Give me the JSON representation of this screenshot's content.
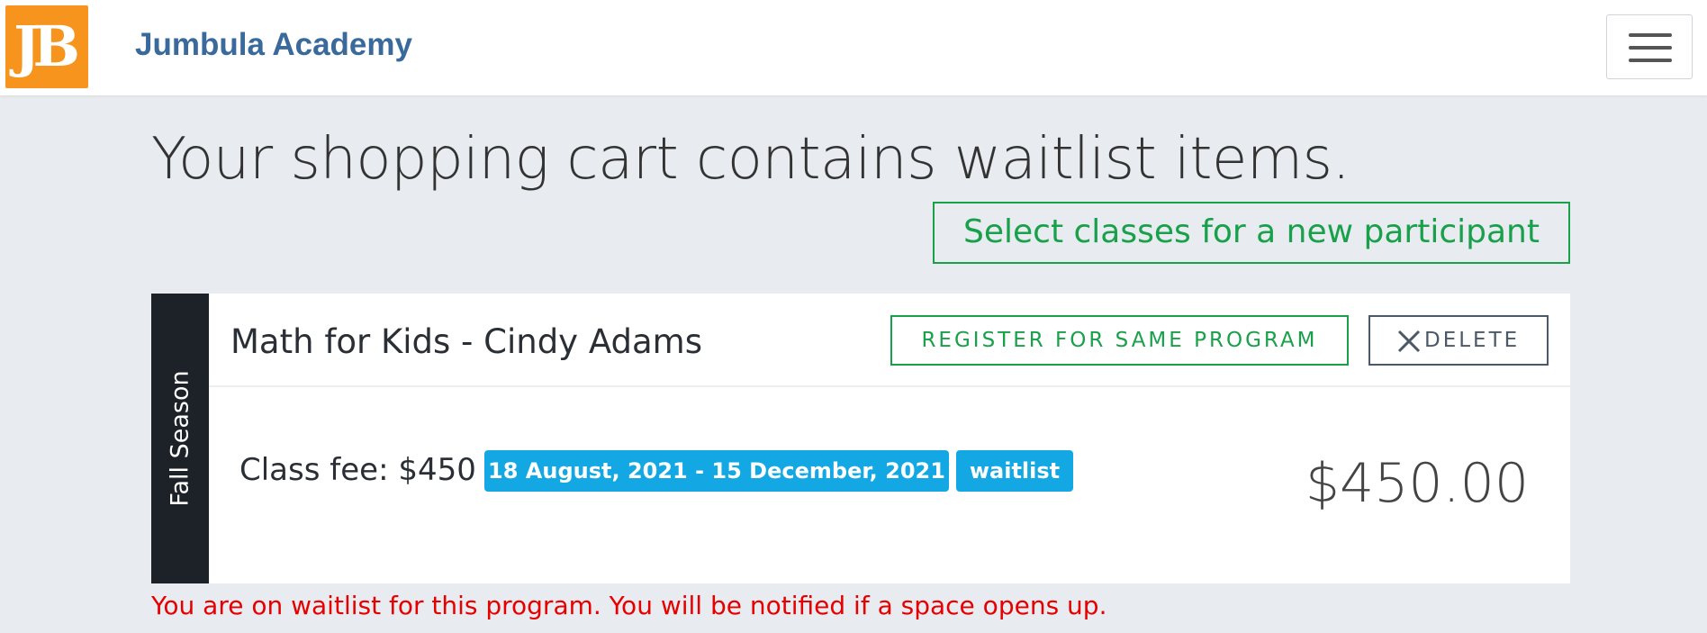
{
  "brand": {
    "logo_text": "JB",
    "name": "Jumbula Academy"
  },
  "nav": {
    "menu_icon": "hamburger-icon"
  },
  "page": {
    "headline": "Your shopping cart contains waitlist items.",
    "new_participant_label": "Select classes for a new participant"
  },
  "cart_item": {
    "season": "Fall Season",
    "title": "Math for Kids - Cindy Adams",
    "register_label": "REGISTER FOR SAME PROGRAM",
    "delete_label": "DELETE",
    "delete_icon": "close-icon",
    "fee_text": "Class fee: $450",
    "date_range": "18 August, 2021 - 15 December, 2021",
    "status_badge": "waitlist",
    "price": "$450.00"
  },
  "notice": "You are on waitlist for this program. You will be notified if a space opens up.",
  "colors": {
    "brand_orange": "#f7941d",
    "brand_blue": "#3a6a9c",
    "success_green": "#19a04a",
    "badge_blue": "#13a8e4",
    "alert_red": "#e60000",
    "season_dark": "#1d2228",
    "page_bg": "#e8ebef"
  }
}
